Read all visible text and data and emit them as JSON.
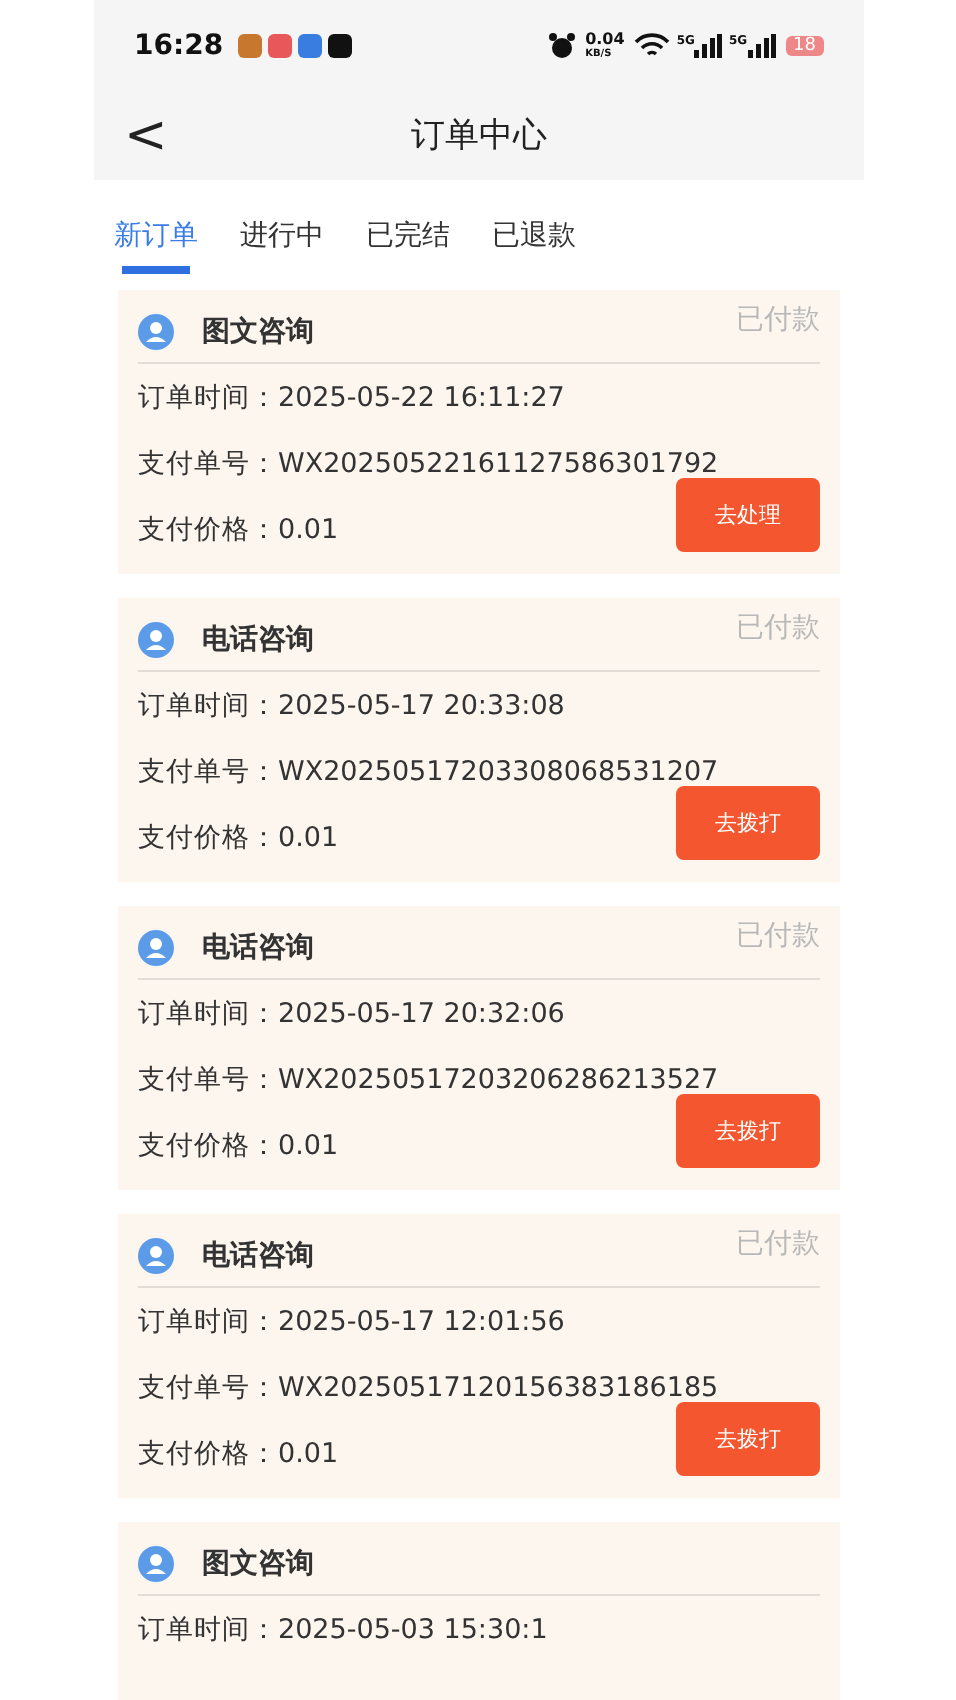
{
  "status_bar": {
    "time": "16:28",
    "speed": "0.04",
    "speed_unit": "KB/S",
    "network_1": "5G",
    "network_2": "5G",
    "battery": "18"
  },
  "header": {
    "back": "<",
    "title": "订单中心"
  },
  "tabs": [
    {
      "label": "新订单",
      "selected": true
    },
    {
      "label": "进行中",
      "selected": false
    },
    {
      "label": "已完结",
      "selected": false
    },
    {
      "label": "已退款",
      "selected": false
    }
  ],
  "orders": [
    {
      "type": "图文咨询",
      "status": "已付款",
      "time": "订单时间：2025-05-22 16:11:27",
      "order_no": "支付单号：WX20250522161127586301792",
      "price": "支付价格：0.01",
      "action": "去处理"
    },
    {
      "type": "电话咨询",
      "status": "已付款",
      "time": "订单时间：2025-05-17 20:33:08",
      "order_no": "支付单号：WX20250517203308068531207",
      "price": "支付价格：0.01",
      "action": "去拨打"
    },
    {
      "type": "电话咨询",
      "status": "已付款",
      "time": "订单时间：2025-05-17 20:32:06",
      "order_no": "支付单号：WX20250517203206286213527",
      "price": "支付价格：0.01",
      "action": "去拨打"
    },
    {
      "type": "电话咨询",
      "status": "已付款",
      "time": "订单时间：2025-05-17 12:01:56",
      "order_no": "支付单号：WX20250517120156383186185",
      "price": "支付价格：0.01",
      "action": "去拨打"
    },
    {
      "type": "图文咨询",
      "time": "订单时间：2025-05-03 15:30:1"
    }
  ]
}
